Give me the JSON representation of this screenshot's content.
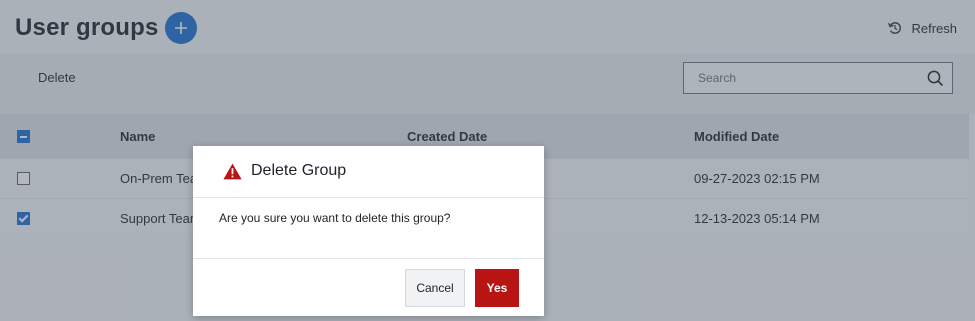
{
  "header": {
    "title": "User groups",
    "refresh_label": "Refresh"
  },
  "toolbar": {
    "delete_label": "Delete",
    "search_placeholder": "Search"
  },
  "table": {
    "columns": [
      "Name",
      "Created Date",
      "Modified Date"
    ],
    "rows": [
      {
        "name": "On-Prem Team",
        "modified": "09-27-2023 02:15 PM",
        "checked": false
      },
      {
        "name": "Support Team",
        "modified": "12-13-2023 05:14 PM",
        "checked": true
      }
    ]
  },
  "dialog": {
    "title": "Delete Group",
    "message": "Are you sure you want to delete this group?",
    "cancel_label": "Cancel",
    "confirm_label": "Yes"
  },
  "colors": {
    "accent": "#1a6fd1",
    "danger": "#b81414"
  },
  "icons": {
    "add": "plus-icon",
    "refresh": "refresh-icon",
    "search": "search-icon",
    "warning": "warning-icon"
  }
}
